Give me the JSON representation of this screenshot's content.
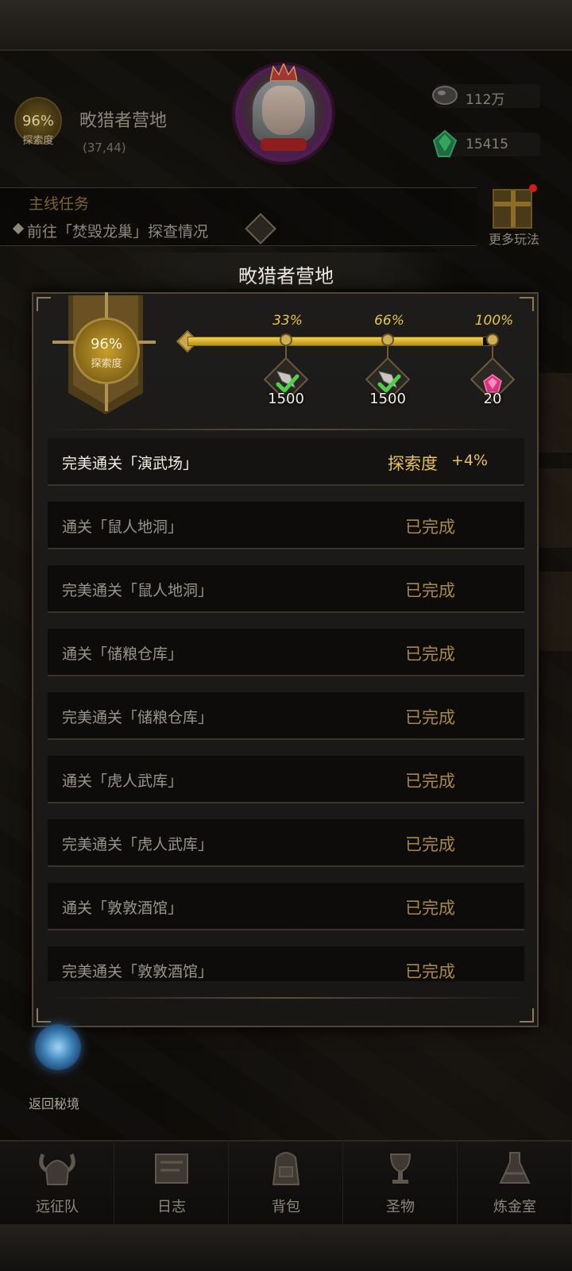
{
  "location": {
    "progress_pct": "96%",
    "progress_label": "探索度",
    "name": "畋猎者营地",
    "coords": "(37,44)"
  },
  "resources": [
    {
      "icon": "ore-icon",
      "value": "112万"
    },
    {
      "icon": "green-gem-icon",
      "value": "15415"
    }
  ],
  "quest": {
    "title": "主线任务",
    "text": "前往「焚毁龙巢」探查情况"
  },
  "more_play": {
    "label": "更多玩法"
  },
  "dialog": {
    "title": "畋猎者营地",
    "exploration": {
      "pct": "96%",
      "label": "探索度",
      "value": 0.96
    },
    "milestones": [
      {
        "pct": "33%",
        "reward": "1500",
        "reward_icon": "arrowhead-icon",
        "claimed": true
      },
      {
        "pct": "66%",
        "reward": "1500",
        "reward_icon": "arrowhead-icon",
        "claimed": true
      },
      {
        "pct": "100%",
        "reward": "20",
        "reward_icon": "pink-crystal-icon",
        "claimed": false
      }
    ],
    "tasks": [
      {
        "name": "完美通关「演武场」",
        "state": "探索度",
        "bonus": "+4%"
      },
      {
        "name": "通关「鼠人地洞」",
        "state": "已完成"
      },
      {
        "name": "完美通关「鼠人地洞」",
        "state": "已完成"
      },
      {
        "name": "通关「储粮仓库」",
        "state": "已完成"
      },
      {
        "name": "完美通关「储粮仓库」",
        "state": "已完成"
      },
      {
        "name": "通关「虎人武库」",
        "state": "已完成"
      },
      {
        "name": "完美通关「虎人武库」",
        "state": "已完成"
      },
      {
        "name": "通关「敦敦酒馆」",
        "state": "已完成"
      },
      {
        "name": "完美通关「敦敦酒馆」",
        "state": "已完成"
      }
    ]
  },
  "portal": {
    "label": "返回秘境"
  },
  "nav": [
    {
      "label": "远征队",
      "icon": "helmet-icon"
    },
    {
      "label": "日志",
      "icon": "scroll-icon"
    },
    {
      "label": "背包",
      "icon": "backpack-icon"
    },
    {
      "label": "圣物",
      "icon": "chalice-icon"
    },
    {
      "label": "炼金室",
      "icon": "alchemy-icon"
    }
  ],
  "colors": {
    "accent_gold": "#e8c35a",
    "completed": "#a88a44",
    "progress_fill": "#f5d24a"
  }
}
